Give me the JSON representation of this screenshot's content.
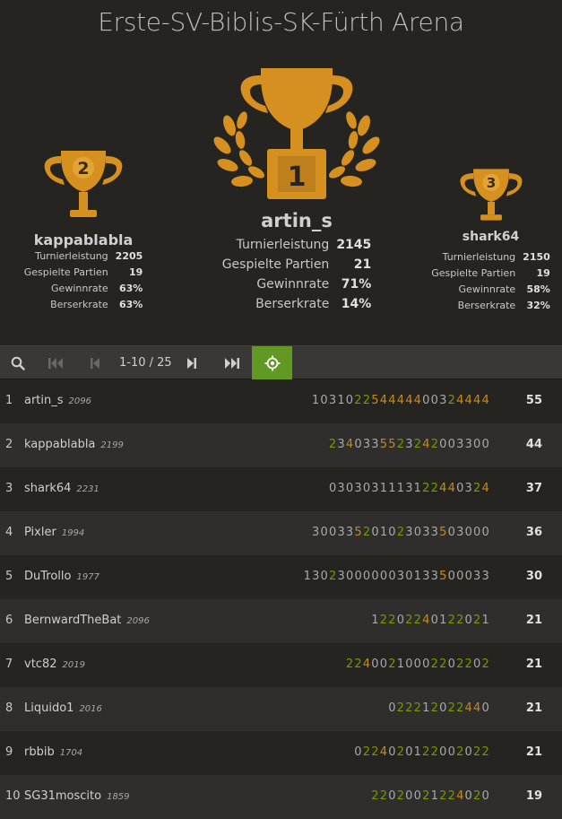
{
  "title": "Erste-SV-Biblis-SK-Fürth Arena",
  "colors": {
    "gold": "#d59020",
    "accent_green": "#629924",
    "streak_green": "#759900",
    "streak_orange": "#c68b1d"
  },
  "podium": {
    "first": {
      "name": "artin_s",
      "trophy_number": "1",
      "stats": [
        {
          "label": "Turnierleistung",
          "value": "2145"
        },
        {
          "label": "Gespielte Partien",
          "value": "21"
        },
        {
          "label": "Gewinnrate",
          "value": "71%"
        },
        {
          "label": "Berserkrate",
          "value": "14%"
        }
      ]
    },
    "second": {
      "name": "kappablabla",
      "trophy_number": "2",
      "stats": [
        {
          "label": "Turnierleistung",
          "value": "2205"
        },
        {
          "label": "Gespielte Partien",
          "value": "19"
        },
        {
          "label": "Gewinnrate",
          "value": "63%"
        },
        {
          "label": "Berserkrate",
          "value": "63%"
        }
      ]
    },
    "third": {
      "name": "shark64",
      "trophy_number": "3",
      "stats": [
        {
          "label": "Turnierleistung",
          "value": "2150"
        },
        {
          "label": "Gespielte Partien",
          "value": "19"
        },
        {
          "label": "Gewinnrate",
          "value": "58%"
        },
        {
          "label": "Berserkrate",
          "value": "32%"
        }
      ]
    }
  },
  "toolbar": {
    "icons": [
      "search-icon",
      "first-page-icon",
      "prev-page-icon",
      "next-page-icon",
      "last-page-icon",
      "locate-icon"
    ],
    "page_range": "1-10 / 25"
  },
  "standings": [
    {
      "rank": "1",
      "name": "artin_s",
      "rating": "2096",
      "sheet": "10310225444440032444 4",
      "score": "55"
    },
    {
      "rank": "2",
      "name": "kappablabla",
      "rating": "2199",
      "sheet": "23403355232420033 00",
      "score": "44"
    },
    {
      "rank": "3",
      "name": "shark64",
      "rating": "2231",
      "sheet": "03030311131224403 24",
      "score": "37"
    },
    {
      "rank": "4",
      "name": "Pixler",
      "rating": "1994",
      "sheet": "30033520102303350 3000",
      "score": "36"
    },
    {
      "rank": "5",
      "name": "DuTrollo",
      "rating": "1977",
      "sheet": "13023000000301335 00033",
      "score": "30"
    },
    {
      "rank": "6",
      "name": "BernwardTheBat",
      "rating": "2096",
      "sheet": "12202240122021",
      "score": "21"
    },
    {
      "rank": "7",
      "name": "vtc82",
      "rating": "2019",
      "sheet": "2240021000220220 2",
      "score": "21"
    },
    {
      "rank": "8",
      "name": "Liquido1",
      "rating": "2016",
      "sheet": "0222120224 40",
      "score": "21"
    },
    {
      "rank": "9",
      "name": "rbbib",
      "rating": "1704",
      "sheet": "0224020122002022",
      "score": "21"
    },
    {
      "rank": "10",
      "name": "SG31moscito",
      "rating": "1859",
      "sheet": "22020021224020",
      "score": "19"
    }
  ]
}
